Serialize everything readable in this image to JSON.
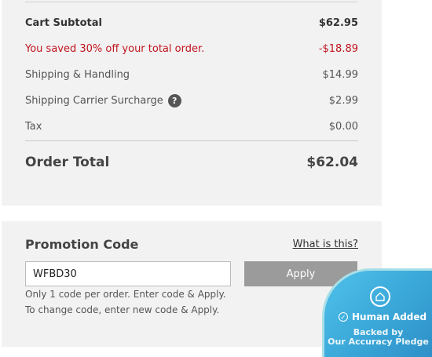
{
  "summary": {
    "subtotal": {
      "label": "Cart Subtotal",
      "value": "$62.95"
    },
    "savings": {
      "label": "You saved 30% off your total order.",
      "value": "-$18.89"
    },
    "shipping": {
      "label": "Shipping & Handling",
      "value": "$14.99"
    },
    "surcharge": {
      "label": "Shipping Carrier Surcharge",
      "value": "$2.99",
      "help_glyph": "?"
    },
    "tax": {
      "label": "Tax",
      "value": "$0.00"
    },
    "total": {
      "label": "Order Total",
      "value": "$62.04"
    }
  },
  "promo": {
    "title": "Promotion Code",
    "link": "What is this?",
    "input_value": "WFBD30",
    "apply_label": "Apply",
    "note_line1": "Only 1 code per order. Enter code & Apply.",
    "note_line2": "To change code, enter new code & Apply."
  },
  "badge": {
    "title": "Human Added",
    "sub1": "Backed by",
    "sub2": "Our Accuracy Pledge",
    "icon": "home-shield-icon"
  },
  "colors": {
    "savings": "#c0141e",
    "apply_button": "#9b9b9b",
    "badge": "#3aa7d8"
  }
}
